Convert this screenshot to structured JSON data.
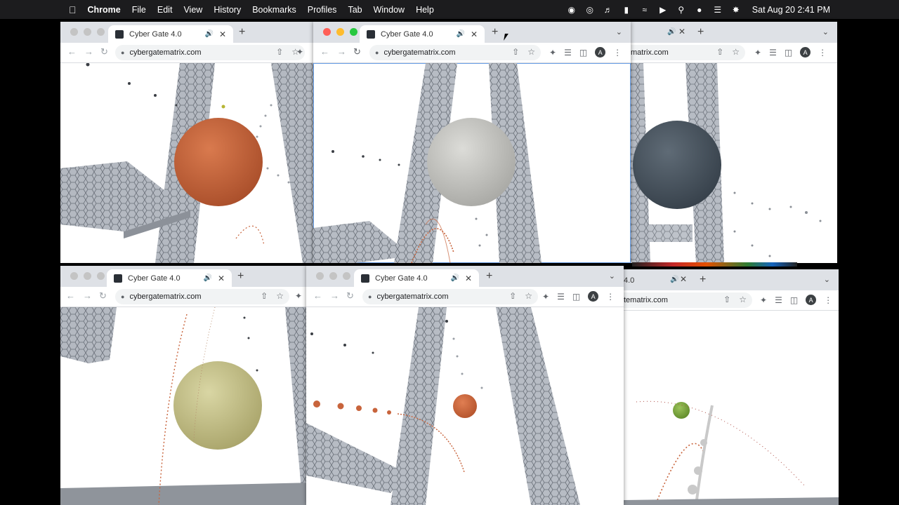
{
  "menubar": {
    "app_name": "Chrome",
    "items": [
      "File",
      "Edit",
      "View",
      "History",
      "Bookmarks",
      "Profiles",
      "Tab",
      "Window",
      "Help"
    ],
    "datetime": "Sat Aug 20  2:41 PM",
    "status_icons": [
      "record-icon",
      "airdrop-icon",
      "volume-icon",
      "battery-icon",
      "wifi-icon",
      "play-icon",
      "search-icon",
      "wechat-icon",
      "control-center-icon",
      "siri-icon"
    ]
  },
  "browser": {
    "tab_title": "Cyber Gate 4.0",
    "tab_title_cut": "4.0",
    "url": "cybergatematrix.com",
    "url_cut": "matrix.com",
    "url_cut_right": "tematrix.com",
    "avatar_letter": "A"
  },
  "scene": {
    "sphere_colors": [
      "#c8643c",
      "#c9c9c4",
      "#4a5560",
      "#c9c58e",
      "#c8643c",
      "#7aa83a"
    ],
    "tower_color": "#a9aeb6",
    "trail_color": "#c8643c"
  }
}
